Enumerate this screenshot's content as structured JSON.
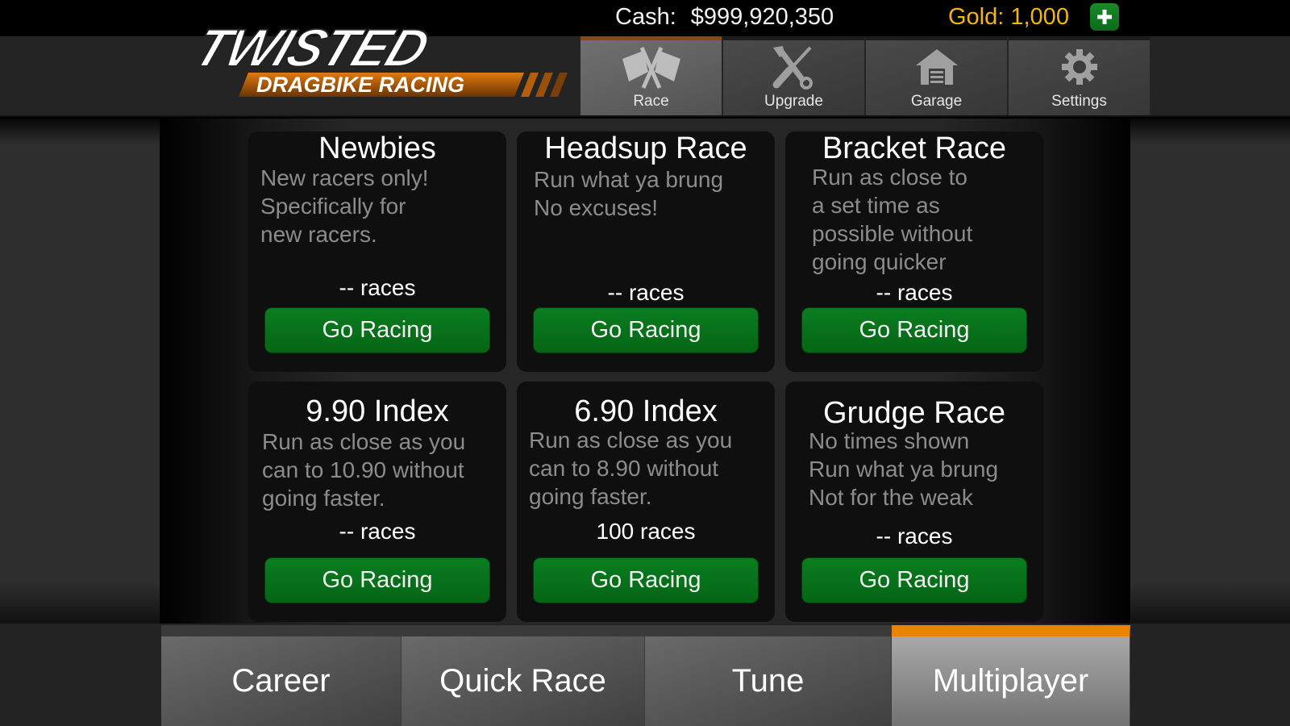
{
  "status": {
    "cash_label": "Cash:",
    "cash_value": "$999,920,350",
    "gold_text": "Gold: 1,000",
    "add_gold_icon": "plus-icon"
  },
  "logo": {
    "title": "TWISTED",
    "subtitle": "DRAGBIKE RACING"
  },
  "nav": {
    "items": [
      {
        "label": "Race",
        "icon": "crossed-flags-icon",
        "active": true
      },
      {
        "label": "Upgrade",
        "icon": "wrench-screwdriver-icon",
        "active": false
      },
      {
        "label": "Garage",
        "icon": "garage-icon",
        "active": false
      },
      {
        "label": "Settings",
        "icon": "gear-icon",
        "active": false
      }
    ]
  },
  "modes": [
    {
      "title": "Newbies",
      "desc": "New racers only!\nSpecifically for\nnew racers.",
      "races": "-- races",
      "button": "Go Racing"
    },
    {
      "title": "Headsup Race",
      "desc": "Run what ya brung\nNo excuses!",
      "races": "-- races",
      "button": "Go Racing"
    },
    {
      "title": "Bracket Race",
      "desc": "Run as close to\na set time as\npossible without\ngoing quicker",
      "races": "-- races",
      "button": "Go Racing"
    },
    {
      "title": "9.90 Index",
      "desc": "Run as close as you\ncan to 10.90 without\ngoing faster.",
      "races": "-- races",
      "button": "Go Racing"
    },
    {
      "title": "6.90 Index",
      "desc": "Run as close as you\ncan to 8.90 without\ngoing faster.",
      "races": "100 races",
      "button": "Go Racing"
    },
    {
      "title": "Grudge Race",
      "desc": "No times shown\nRun what ya brung\nNot for the weak",
      "races": "-- races",
      "button": "Go Racing"
    }
  ],
  "tabs": [
    {
      "label": "Career",
      "active": false
    },
    {
      "label": "Quick Race",
      "active": false
    },
    {
      "label": "Tune",
      "active": false
    },
    {
      "label": "Multiplayer",
      "active": true
    }
  ],
  "colors": {
    "accent_orange": "#e88400",
    "go_green": "#0a7d20",
    "gold_text": "#f3b417"
  }
}
